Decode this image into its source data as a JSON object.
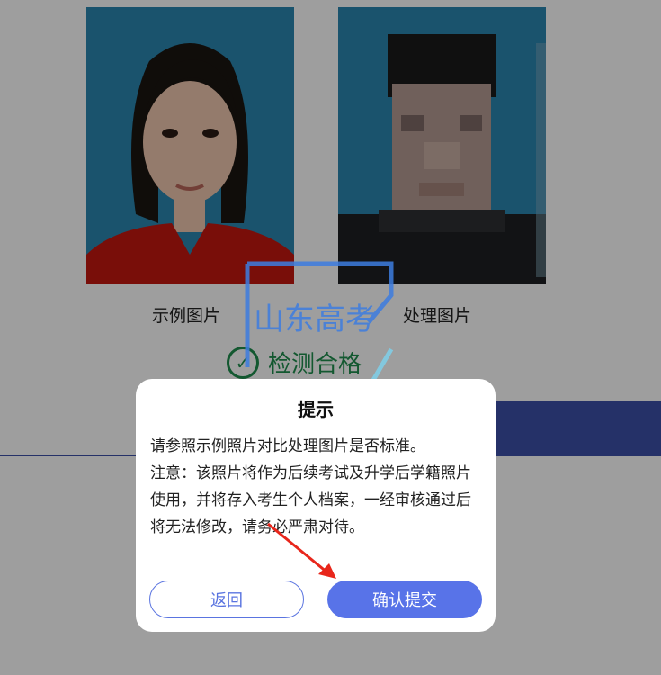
{
  "photos": {
    "sample_caption": "示例图片",
    "processed_caption": "处理图片"
  },
  "check_result": "检测合格",
  "watermark_text": "山东高考",
  "dialog": {
    "title": "提示",
    "line1": "请参照示例照片对比处理图片是否标准。",
    "line2": "注意：该照片将作为后续考试及升学后学籍照片使用，并将存入考生个人档案，一经审核通过后将无法修改，请务必严肃对待。",
    "back_label": "返回",
    "confirm_label": "确认提交"
  },
  "colors": {
    "accent": "#5873e8",
    "pass_green": "#1f8f4e",
    "photo_bg": "#2a86b0",
    "band_blue": "#3d4fa8"
  }
}
